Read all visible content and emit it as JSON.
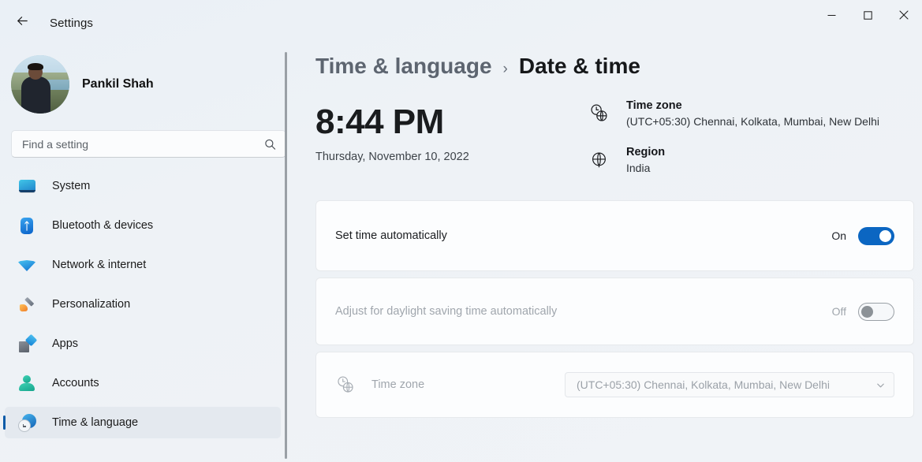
{
  "titlebar": {
    "back_icon": "back-arrow-icon",
    "app_title": "Settings",
    "minimize_icon": "minimize-icon",
    "maximize_icon": "maximize-icon",
    "close_icon": "close-icon"
  },
  "sidebar": {
    "profile": {
      "name": "Pankil Shah",
      "avatar_icon": "user-avatar"
    },
    "search": {
      "placeholder": "Find a setting",
      "icon": "search-icon"
    },
    "items": [
      {
        "label": "System",
        "icon": "monitor-icon",
        "active": false
      },
      {
        "label": "Bluetooth & devices",
        "icon": "bluetooth-icon",
        "active": false
      },
      {
        "label": "Network & internet",
        "icon": "wifi-icon",
        "active": false
      },
      {
        "label": "Personalization",
        "icon": "paintbrush-icon",
        "active": false
      },
      {
        "label": "Apps",
        "icon": "apps-icon",
        "active": false
      },
      {
        "label": "Accounts",
        "icon": "person-icon",
        "active": false
      },
      {
        "label": "Time & language",
        "icon": "clock-globe-icon",
        "active": true
      }
    ]
  },
  "breadcrumb": {
    "parent": "Time & language",
    "separator": "›",
    "current": "Date & time"
  },
  "clock": {
    "time": "8:44 PM",
    "date": "Thursday, November 10, 2022"
  },
  "info": [
    {
      "icon": "clock-globe-icon",
      "title": "Time zone",
      "value": "(UTC+05:30) Chennai, Kolkata, Mumbai, New Delhi"
    },
    {
      "icon": "globe-icon",
      "title": "Region",
      "value": "India"
    }
  ],
  "settings": [
    {
      "title": "Set time automatically",
      "state_label": "On",
      "toggle": "on",
      "disabled": false
    },
    {
      "title": "Adjust for daylight saving time automatically",
      "state_label": "Off",
      "toggle": "off",
      "disabled": true
    }
  ],
  "timezone_row": {
    "icon": "clock-globe-icon",
    "label": "Time zone",
    "selected": "(UTC+05:30) Chennai, Kolkata, Mumbai, New Delhi",
    "chevron_icon": "chevron-down-icon"
  },
  "colors": {
    "accent": "#0b66c2",
    "selection_bar": "#0c5ba8",
    "background": "#eef2f6",
    "card": "#fcfdfe"
  }
}
